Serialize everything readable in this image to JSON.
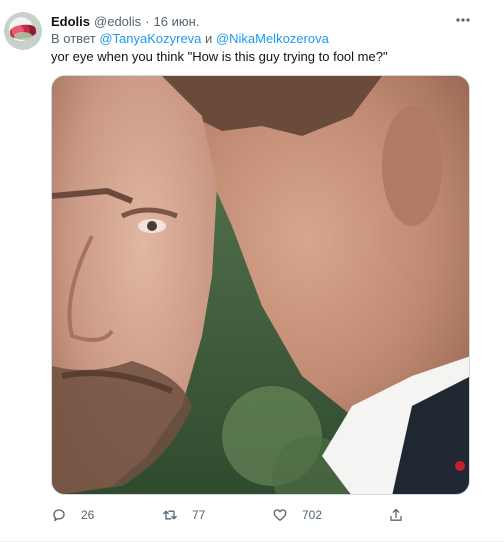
{
  "tweet": {
    "author_name": "Edolis",
    "handle": "@edolis",
    "separator": "·",
    "date": "16 июн.",
    "reply_prefix": "В ответ",
    "mention_1": "@TanyaKozyreva",
    "reply_and": "и",
    "mention_2": "@NikaMelkozerova",
    "text": "yor eye when you think \"How is this guy trying to fool me?\""
  },
  "actions": {
    "replies": "26",
    "retweets": "77",
    "likes": "702"
  },
  "icons": {
    "more": "more-horizontal-icon",
    "reply": "reply-icon",
    "retweet": "retweet-icon",
    "like": "heart-icon",
    "share": "share-icon"
  },
  "colors": {
    "link": "#1d9bf0",
    "secondary_text": "#536471",
    "primary_text": "#0f1419"
  }
}
